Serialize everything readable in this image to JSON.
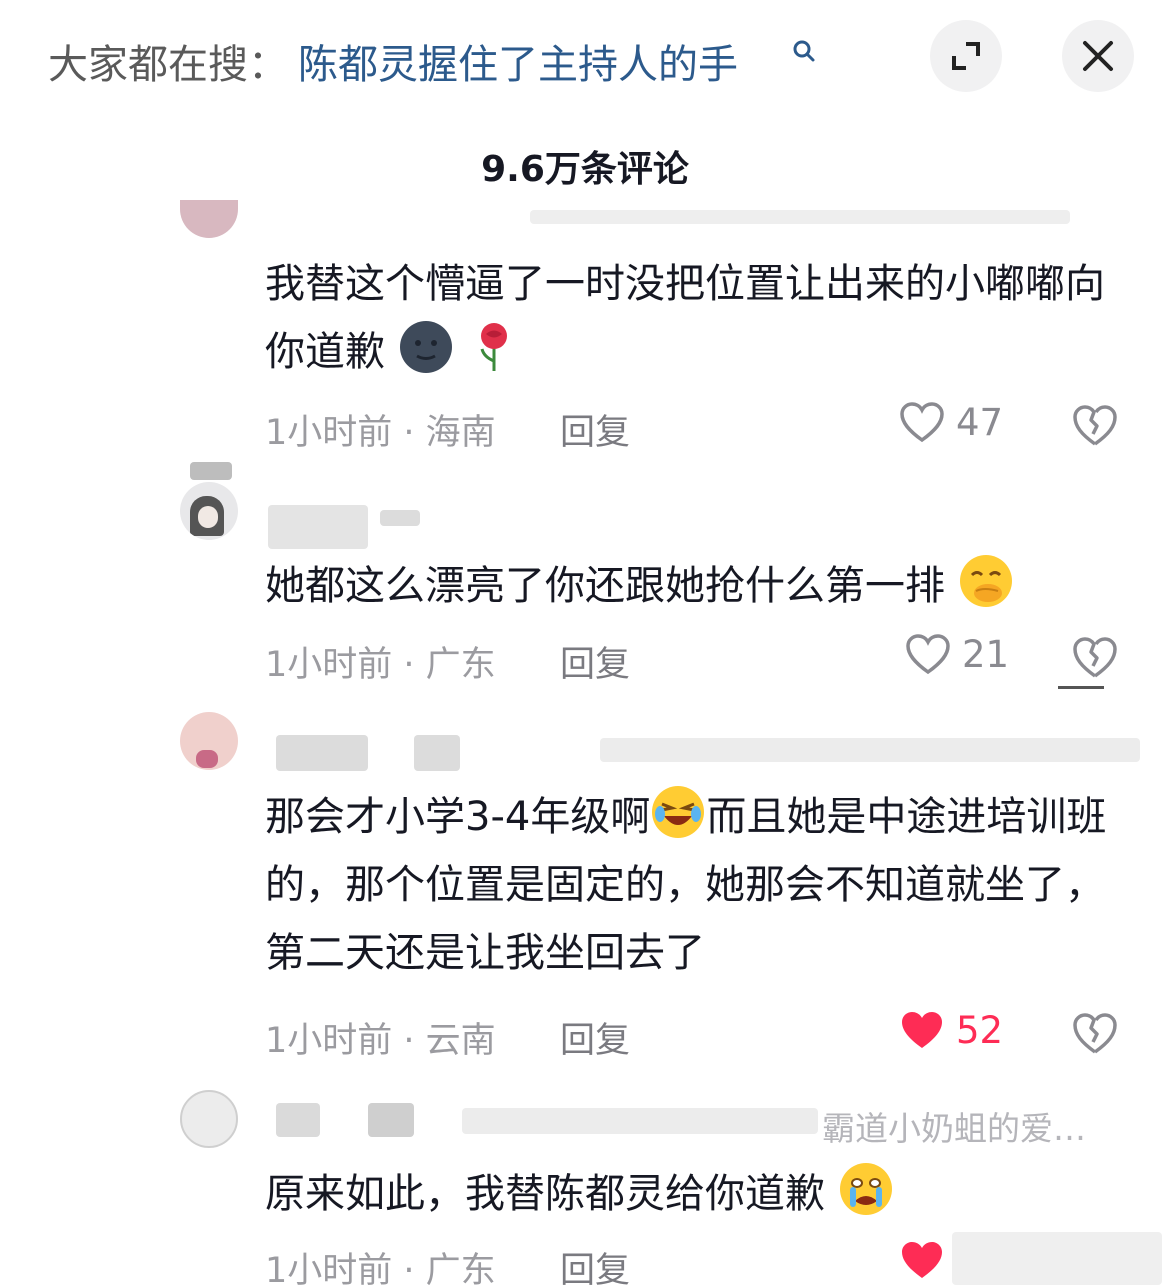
{
  "header": {
    "search_prefix": "大家都在搜：",
    "search_term": "陈都灵握住了主持人的手"
  },
  "comments_count": "9.6万条评论",
  "comments": [
    {
      "text": "我替这个懵逼了一时没把位置让出来的小嘟嘟向你道歉",
      "emojis": [
        "new-moon-face-icon",
        "rose-icon"
      ],
      "time_location": "1小时前 · 海南",
      "reply_label": "回复",
      "likes": "47",
      "liked": false
    },
    {
      "text": "她都这么漂亮了你还跟她抢什么第一排",
      "emojis": [
        "face-with-hand-over-mouth-icon"
      ],
      "time_location": "1小时前 · 广东",
      "reply_label": "回复",
      "likes": "21",
      "liked": false
    },
    {
      "text_part1": "那会才小学3-4年级啊",
      "text_part2": "而且她是中途进培训班的，那个位置是固定的，她那会不知道就坐了，第二天还是让我坐回去了",
      "emojis": [
        "rolling-laughing-face-icon"
      ],
      "time_location": "1小时前 · 云南",
      "reply_label": "回复",
      "likes": "52",
      "liked": true
    },
    {
      "text": "原来如此，我替陈都灵给你道歉",
      "emojis": [
        "loudly-crying-face-icon"
      ],
      "header_partial": "霸道小奶蛆的爱…",
      "time_location": "1小时前 · 广东",
      "reply_label": "回复",
      "liked": true
    }
  ],
  "colors": {
    "accent_like": "#fe2c55",
    "search_term": "#2c5a8c"
  }
}
